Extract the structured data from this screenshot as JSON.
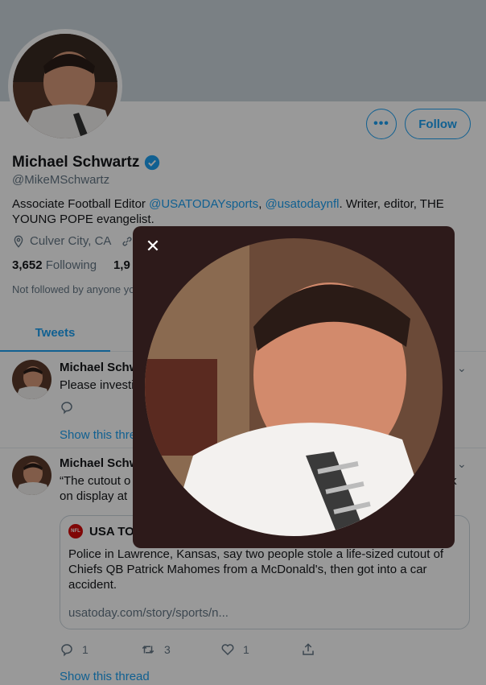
{
  "profile": {
    "name": "Michael Schwartz",
    "handle": "@MikeMSchwartz",
    "bio_prefix": "Associate Football Editor ",
    "bio_link1": "@USATODAYsports",
    "bio_sep": ", ",
    "bio_link2": "@usatodaynfl",
    "bio_suffix": ". Writer, editor, THE YOUNG POPE evangelist.",
    "location": "Culver City, CA",
    "following_count": "3,652",
    "following_label": "Following",
    "followers_count": "1,9",
    "followed_note": "Not followed by anyone yo"
  },
  "buttons": {
    "more": "•••",
    "follow": "Follow"
  },
  "tabs": {
    "tweets": "Tweets"
  },
  "tweets": [
    {
      "name": "Michael Schw",
      "text": "Please investig",
      "show_thread": "Show this thre"
    },
    {
      "name": "Michael Schw",
      "text_line1": "“The cutout o",
      "text_line1_tail": "k",
      "text_line2": "on display at",
      "card": {
        "title": "USA TO",
        "logo_text": "NFL",
        "text": "Police in Lawrence, Kansas, say two people stole a life-sized cutout of Chiefs QB Patrick Mahomes from a McDonald's, then got into a car accident.",
        "url": "usatoday.com/story/sports/n..."
      },
      "replies": "1",
      "retweets": "3",
      "likes": "1",
      "show_thread": "Show this thread"
    }
  ],
  "modal": {
    "close": "✕"
  },
  "colors": {
    "accent": "#1da1f2",
    "banner": "#ccd6dd",
    "modal_bg": "#2d1a1a"
  }
}
